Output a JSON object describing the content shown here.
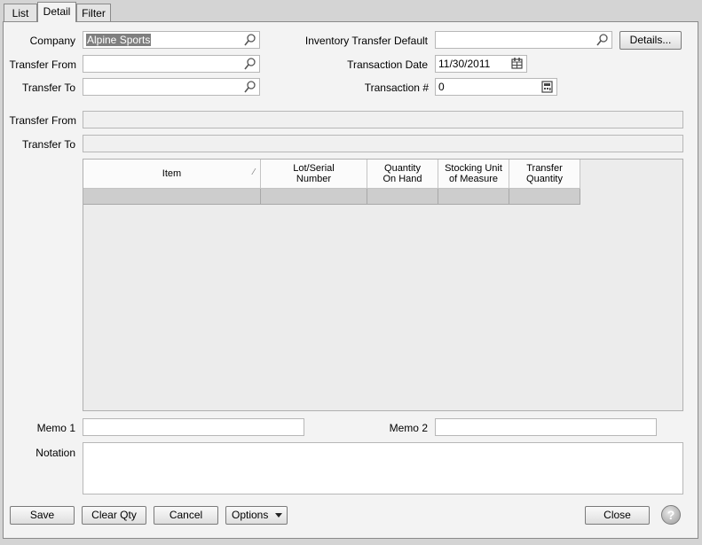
{
  "tabs": [
    {
      "label": "List"
    },
    {
      "label": "Detail"
    },
    {
      "label": "Filter"
    }
  ],
  "form": {
    "company_label": "Company",
    "company_value": "Alpine Sports",
    "transfer_from_label": "Transfer From",
    "transfer_from_value": "",
    "transfer_to_label": "Transfer To",
    "transfer_to_value": "",
    "inv_default_label": "Inventory Transfer Default",
    "inv_default_value": "",
    "details_button": "Details...",
    "trans_date_label": "Transaction Date",
    "trans_date_value": "11/30/2011",
    "trans_num_label": "Transaction #",
    "trans_num_value": "0",
    "transfer_from_desc_label": "Transfer From",
    "transfer_to_desc_label": "Transfer To"
  },
  "grid": {
    "columns": [
      {
        "label": "Item"
      },
      {
        "label": "Lot/Serial\nNumber"
      },
      {
        "label": "Quantity\nOn Hand"
      },
      {
        "label": "Stocking Unit\nof Measure"
      },
      {
        "label": "Transfer\nQuantity"
      }
    ],
    "sort_indicator": "⁄"
  },
  "memo": {
    "memo1_label": "Memo 1",
    "memo1_value": "",
    "memo2_label": "Memo 2",
    "memo2_value": "",
    "notation_label": "Notation",
    "notation_value": ""
  },
  "footer": {
    "save": "Save",
    "clear_qty": "Clear Qty",
    "cancel": "Cancel",
    "options": "Options",
    "close": "Close",
    "help": "?"
  },
  "icons": {
    "lookup": "magnifier-icon",
    "calendar": "calendar-icon",
    "calculator": "calculator-icon",
    "dropdown": "dropdown-arrow-icon",
    "help": "help-icon"
  }
}
